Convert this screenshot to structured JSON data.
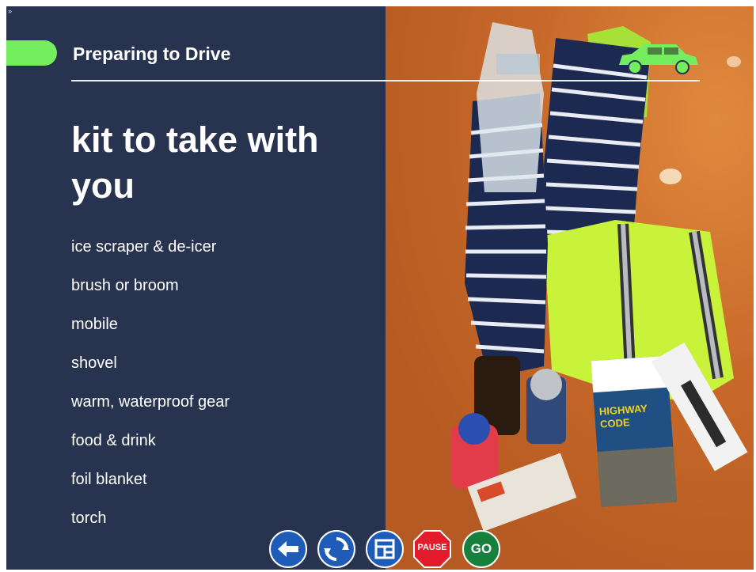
{
  "header": {
    "title": "Preparing to Drive",
    "accent_color": "#74ee5e"
  },
  "expand_toggle": "»",
  "main": {
    "heading": "kit to take with you",
    "items": [
      "ice scraper & de-icer",
      "brush or broom",
      "mobile",
      "shovel",
      "warm, waterproof gear",
      "food & drink",
      "foil blanket",
      "torch"
    ]
  },
  "nav": {
    "back_icon": "arrow-left-icon",
    "replay_icon": "refresh-icon",
    "menu_icon": "grid-icon",
    "pause_label": "PAUSE",
    "go_label": "GO"
  },
  "colors": {
    "panel": "#28344f",
    "nav_blue": "#1f5cb8",
    "pause_red": "#e31b2a",
    "go_green": "#17803d"
  }
}
